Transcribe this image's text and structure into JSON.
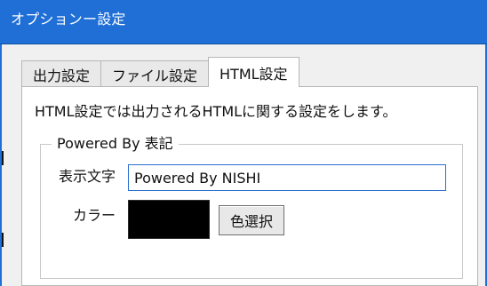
{
  "window": {
    "title": "オプションー設定"
  },
  "tabs": [
    {
      "label": "出力設定",
      "active": false
    },
    {
      "label": "ファイル設定",
      "active": false
    },
    {
      "label": "HTML設定",
      "active": true
    }
  ],
  "html_settings": {
    "description": "HTML設定では出力されるHTMLに関する設定をします。",
    "powered_by_group": {
      "label": "Powered By 表記",
      "display_text": {
        "label": "表示文字",
        "value": "Powered By NISHI"
      },
      "color": {
        "label": "カラー",
        "swatch_hex": "#000000",
        "pick_button_label": "色選択"
      }
    }
  },
  "colors": {
    "titlebar": "#1f6fd6",
    "input_focus": "#2b6fd1"
  }
}
